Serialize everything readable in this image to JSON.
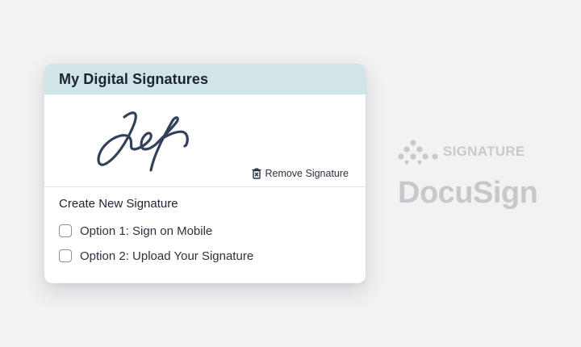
{
  "card": {
    "title": "My Digital Signatures",
    "remove_label": "Remove Signature",
    "create_title": "Create New Signature",
    "options": [
      {
        "label": "Option 1: Sign on Mobile",
        "checked": false
      },
      {
        "label": "Option 2: Upload Your Signature",
        "checked": false
      }
    ]
  },
  "brand": {
    "signature_text": "SIGNATURE",
    "logo_text": "DocuSign"
  },
  "icons": {
    "remove": "trash-icon",
    "brand_mark": "dots-cluster-icon"
  },
  "colors": {
    "header_bg": "#d1e5e8",
    "signature_ink": "#33405a",
    "brand_gray": "#c6c8cc"
  }
}
